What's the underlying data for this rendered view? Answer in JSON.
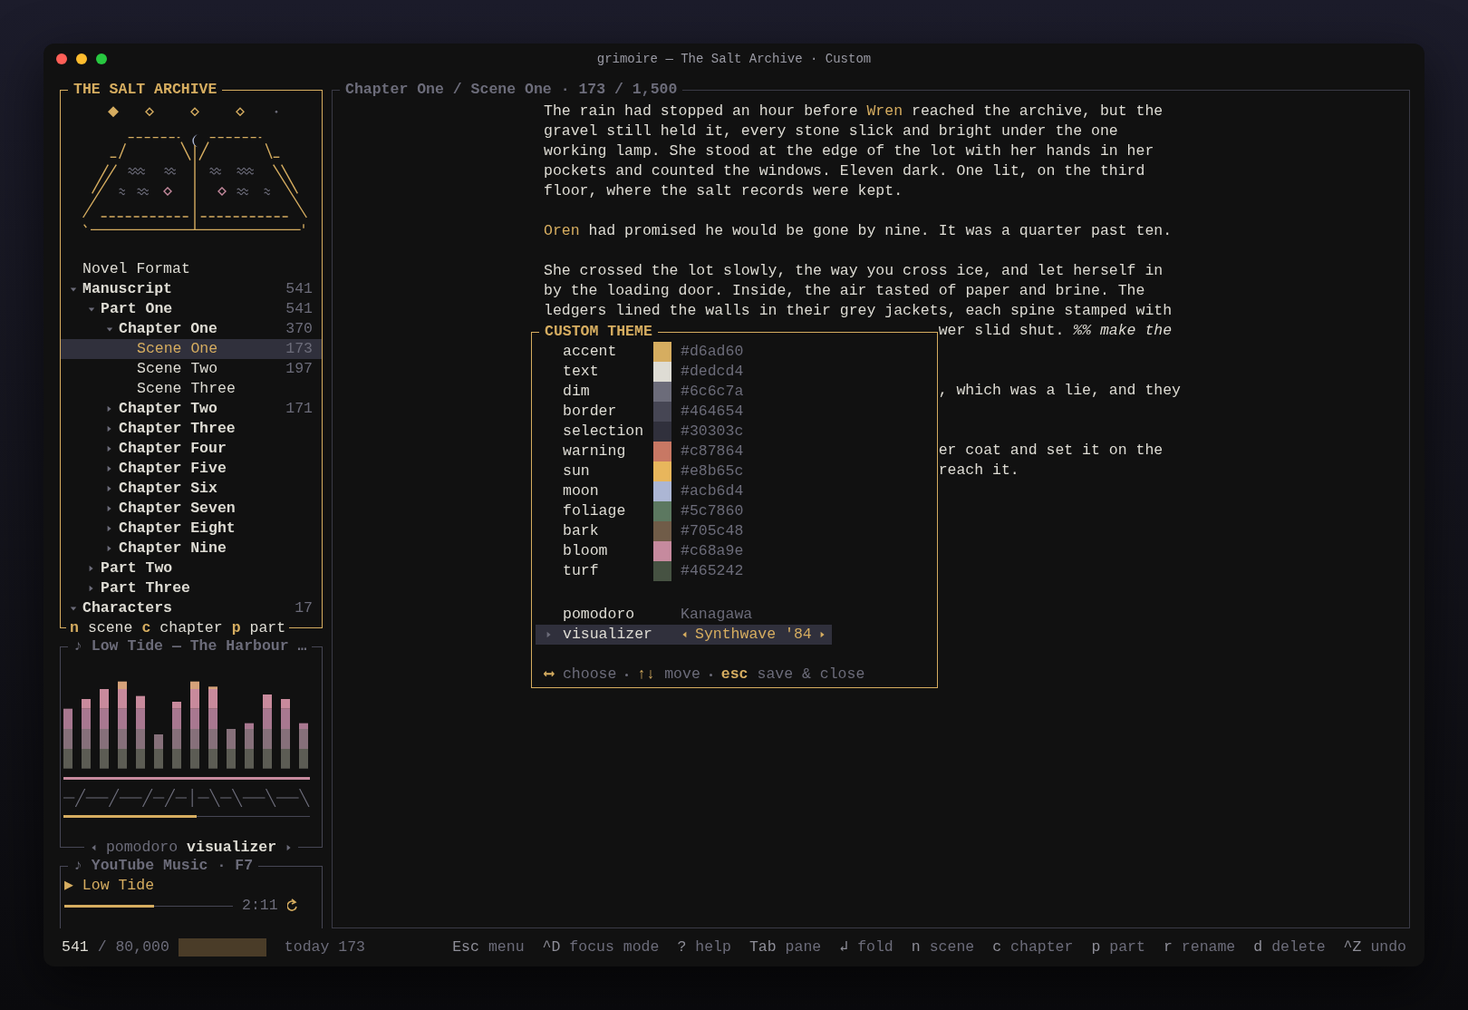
{
  "window": {
    "title": "grimoire — The Salt Archive · Custom"
  },
  "sidebar": {
    "title": "THE SALT ARCHIVE",
    "tree": [
      {
        "label": "Novel Format",
        "kind": "leaf",
        "selected": false
      },
      {
        "label": "Manuscript",
        "kind": "group",
        "count": "541",
        "expanded": true,
        "selected": false,
        "children": [
          {
            "label": "Part One",
            "kind": "group",
            "count": "541",
            "expanded": true,
            "selected": false,
            "children": [
              {
                "label": "Chapter One",
                "kind": "group",
                "count": "370",
                "expanded": true,
                "selected": false,
                "children": [
                  {
                    "label": "Scene One",
                    "kind": "leaf",
                    "count": "173",
                    "selected": true
                  },
                  {
                    "label": "Scene Two",
                    "kind": "leaf",
                    "count": "197",
                    "selected": false
                  },
                  {
                    "label": "Scene Three",
                    "kind": "leaf",
                    "selected": false
                  }
                ]
              },
              {
                "label": "Chapter Two",
                "kind": "group",
                "count": "171",
                "expanded": false,
                "selected": false
              },
              {
                "label": "Chapter Three",
                "kind": "group",
                "expanded": false,
                "selected": false
              },
              {
                "label": "Chapter Four",
                "kind": "group",
                "expanded": false,
                "selected": false
              },
              {
                "label": "Chapter Five",
                "kind": "group",
                "expanded": false,
                "selected": false
              },
              {
                "label": "Chapter Six",
                "kind": "group",
                "expanded": false,
                "selected": false
              },
              {
                "label": "Chapter Seven",
                "kind": "group",
                "expanded": false,
                "selected": false
              },
              {
                "label": "Chapter Eight",
                "kind": "group",
                "expanded": false,
                "selected": false
              },
              {
                "label": "Chapter Nine",
                "kind": "group",
                "expanded": false,
                "selected": false
              }
            ]
          },
          {
            "label": "Part Two",
            "kind": "group",
            "expanded": false,
            "selected": false
          },
          {
            "label": "Part Three",
            "kind": "group",
            "expanded": false,
            "selected": false
          }
        ]
      },
      {
        "label": "Characters",
        "kind": "group",
        "count": "17",
        "expanded": true,
        "selected": false
      }
    ],
    "hints": [
      {
        "key": "n",
        "label": "scene"
      },
      {
        "key": "c",
        "label": "chapter"
      },
      {
        "key": "p",
        "label": "part"
      }
    ]
  },
  "visualizer": {
    "title": "♪ Low Tide — The Harbour …",
    "level": 0.54,
    "tabs": [
      {
        "label": "pomodoro",
        "selected": false
      },
      {
        "label": "visualizer",
        "selected": true
      }
    ]
  },
  "music": {
    "title": "♪ YouTube Music · F7",
    "track": "▶ Low Tide",
    "level": 0.53,
    "time": "2:11"
  },
  "editor": {
    "title": "Chapter One / Scene One · 173 / 1,500",
    "lines": [
      {
        "kind": "text",
        "text": "The rain had stopped an hour before **Wren** reached the archive, but the"
      },
      {
        "kind": "text",
        "text": "gravel still held it, every stone slick and bright under the one"
      },
      {
        "kind": "text",
        "text": "working lamp. She stood at the edge of the lot with her hands in her"
      },
      {
        "kind": "text",
        "text": "pockets and counted the windows. Eleven dark. One lit, on the third"
      },
      {
        "kind": "text",
        "text": "floor, where the salt records were kept."
      },
      {
        "kind": "blank"
      },
      {
        "kind": "text",
        "text": "**Oren** had promised he would be gone by nine. It was a quarter past ten."
      },
      {
        "kind": "blank"
      },
      {
        "kind": "text",
        "text": "She crossed the lot slowly, the way you cross ice, and let herself in"
      },
      {
        "kind": "text",
        "text": "by the loading door. Inside, the air tasted of paper and brine. The"
      },
      {
        "kind": "text",
        "text": "ledgers lined the walls in their grey jackets, each spine stamped with"
      },
      {
        "kind": "fragment",
        "text": "wer slid shut. *%% make the*"
      },
      {
        "kind": "blank"
      },
      {
        "kind": "blank"
      },
      {
        "kind": "fragment",
        "text": ", which was a lie, and they"
      },
      {
        "kind": "blank"
      },
      {
        "kind": "blank"
      },
      {
        "kind": "fragment",
        "text": "er coat and set it on the"
      },
      {
        "kind": "fragment",
        "text": "reach it."
      }
    ]
  },
  "theme_dialog": {
    "title": "CUSTOM THEME",
    "colors": [
      {
        "name": "accent",
        "color": "#d6ad60",
        "hex": "#d6ad60"
      },
      {
        "name": "text",
        "color": "#dedcd4",
        "hex": "#dedcd4"
      },
      {
        "name": "dim",
        "color": "#6c6c7a",
        "hex": "#6c6c7a"
      },
      {
        "name": "border",
        "color": "#464654",
        "hex": "#464654"
      },
      {
        "name": "selection",
        "color": "#30303c",
        "hex": "#30303c"
      },
      {
        "name": "warning",
        "color": "#c87864",
        "hex": "#c87864"
      },
      {
        "name": "sun",
        "color": "#e8b65c",
        "hex": "#e8b65c"
      },
      {
        "name": "moon",
        "color": "#acb6d4",
        "hex": "#acb6d4"
      },
      {
        "name": "foliage",
        "color": "#5c7860",
        "hex": "#5c7860"
      },
      {
        "name": "bark",
        "color": "#705c48",
        "hex": "#705c48"
      },
      {
        "name": "bloom",
        "color": "#c68a9e",
        "hex": "#c68a9e"
      },
      {
        "name": "turf",
        "color": "#465242",
        "hex": "#465242"
      }
    ],
    "options": [
      {
        "name": "pomodoro",
        "value": "Kanagawa",
        "selected": false
      },
      {
        "name": "visualizer",
        "value": "Synthwave '84",
        "selected": true
      }
    ],
    "hints": [
      {
        "key": "⟷",
        "label": "choose"
      },
      {
        "key": "↑↓",
        "label": "move"
      },
      {
        "key": "esc",
        "label": "save & close"
      }
    ]
  },
  "status_bar": {
    "words": "541",
    "goal": "/ 80,000",
    "today": "today 173",
    "shortcuts": [
      {
        "key": "Esc",
        "label": "menu"
      },
      {
        "key": "^D",
        "label": "focus mode"
      },
      {
        "key": "?",
        "label": "help"
      },
      {
        "key": "Tab",
        "label": "pane"
      },
      {
        "key": "↲",
        "label": "fold"
      },
      {
        "key": "n",
        "label": "scene"
      },
      {
        "key": "c",
        "label": "chapter"
      },
      {
        "key": "p",
        "label": "part"
      },
      {
        "key": "r",
        "label": "rename"
      },
      {
        "key": "d",
        "label": "delete"
      },
      {
        "key": "^Z",
        "label": "undo"
      }
    ]
  }
}
